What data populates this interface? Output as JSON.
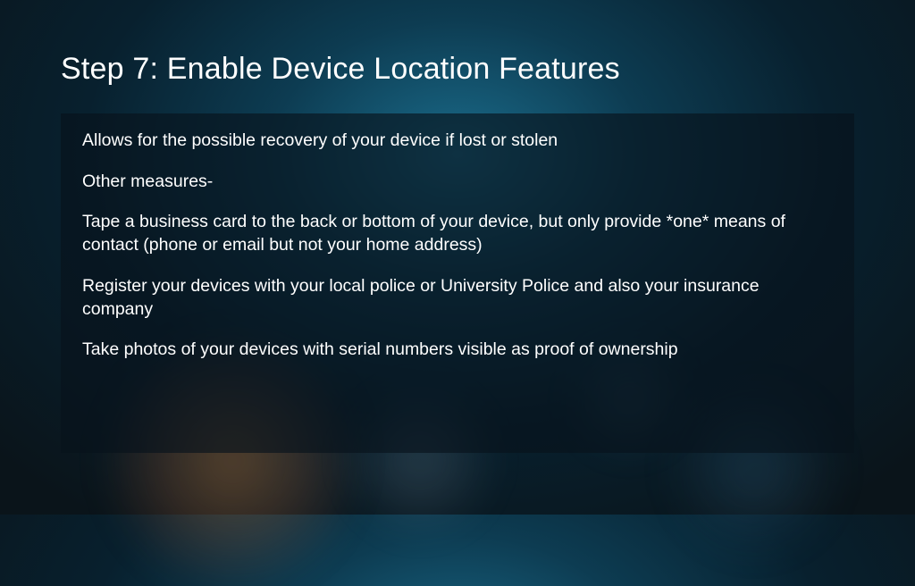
{
  "slide": {
    "title": "Step 7: Enable Device Location Features",
    "paragraphs": [
      "Allows for the possible recovery of your device if lost or stolen",
      "Other measures-",
      "Tape a business card to the back or bottom of your device, but only provide *one* means of contact (phone or email but not your home address)",
      "Register your devices with your local police or University Police and also your insurance company",
      "Take photos of your devices with serial numbers visible as proof of ownership"
    ]
  }
}
